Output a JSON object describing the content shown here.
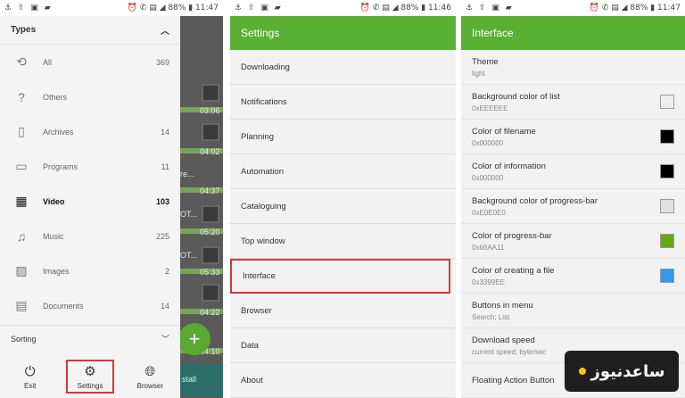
{
  "status_bars": [
    {
      "left": "⚓ ⇪ ▣ ▰",
      "right": "⏰ ✆ ▤ ◢ 88% ▮ 11:47"
    },
    {
      "left": "⚓ ⇪ ▣ ▰",
      "right": "⏰ ✆ ▤ ◢ 88% ▮ 11:46"
    },
    {
      "left": "⚓ ⇪ ▣ ▰",
      "right": "⏰ ✆ ▤ ◢ 88% ▮ 11:47"
    }
  ],
  "drawer": {
    "types_label": "Types",
    "items": [
      {
        "label": "All",
        "count": "369",
        "icon": "sync-icon",
        "glyph": "⟲"
      },
      {
        "label": "Others",
        "count": "",
        "icon": "question-icon",
        "glyph": "?"
      },
      {
        "label": "Archives",
        "count": "14",
        "icon": "archive-icon",
        "glyph": "▯"
      },
      {
        "label": "Programs",
        "count": "11",
        "icon": "monitor-icon",
        "glyph": "▭"
      },
      {
        "label": "Video",
        "count": "103",
        "icon": "film-icon",
        "glyph": "▦"
      },
      {
        "label": "Music",
        "count": "225",
        "icon": "music-icon",
        "glyph": "♫"
      },
      {
        "label": "Images",
        "count": "2",
        "icon": "image-icon",
        "glyph": "▨"
      },
      {
        "label": "Documents",
        "count": "14",
        "icon": "document-icon",
        "glyph": "▤"
      }
    ],
    "sorting_label": "Sorting",
    "bottom_nav": {
      "exit": "Exit",
      "settings": "Settings",
      "browser": "Browser"
    }
  },
  "background_list": {
    "fragments": [
      "03:06",
      "04:02",
      "re...",
      "04:37",
      "OT...",
      "05:20",
      "OT...",
      "05:33",
      "04:22",
      "04:10"
    ],
    "install_label": "stall"
  },
  "settings": {
    "title": "Settings",
    "items": [
      "Downloading",
      "Notifications",
      "Planning",
      "Automation",
      "Cataloguing",
      "Top window",
      "Interface",
      "Browser",
      "Data",
      "About"
    ]
  },
  "interface": {
    "title": "Interface",
    "prefs": [
      {
        "title": "Theme",
        "sub": "light",
        "swatch": null
      },
      {
        "title": "Background color of list",
        "sub": "0xEEEEEE",
        "swatch": "#EEEEEE"
      },
      {
        "title": "Color of filename",
        "sub": "0x000000",
        "swatch": "#000000"
      },
      {
        "title": "Color of information",
        "sub": "0x000000",
        "swatch": "#000000"
      },
      {
        "title": "Background color of progress-bar",
        "sub": "0xE0E0E0",
        "swatch": "#E0E0E0"
      },
      {
        "title": "Color of progress-bar",
        "sub": "0x66AA11",
        "swatch": "#66AA11"
      },
      {
        "title": "Color of creating a file",
        "sub": "0x3399EE",
        "swatch": "#3399EE"
      },
      {
        "title": "Buttons in menu",
        "sub": "Search; List",
        "swatch": null
      },
      {
        "title": "Download speed",
        "sub": "current speed; byte/sec",
        "swatch": null
      },
      {
        "title": "Floating Action Button",
        "sub": "",
        "swatch": null
      }
    ]
  },
  "watermark": {
    "text": "ساعدنیوز"
  },
  "colors": {
    "accent_green": "#5ab032",
    "highlight_red": "#d9363e"
  }
}
